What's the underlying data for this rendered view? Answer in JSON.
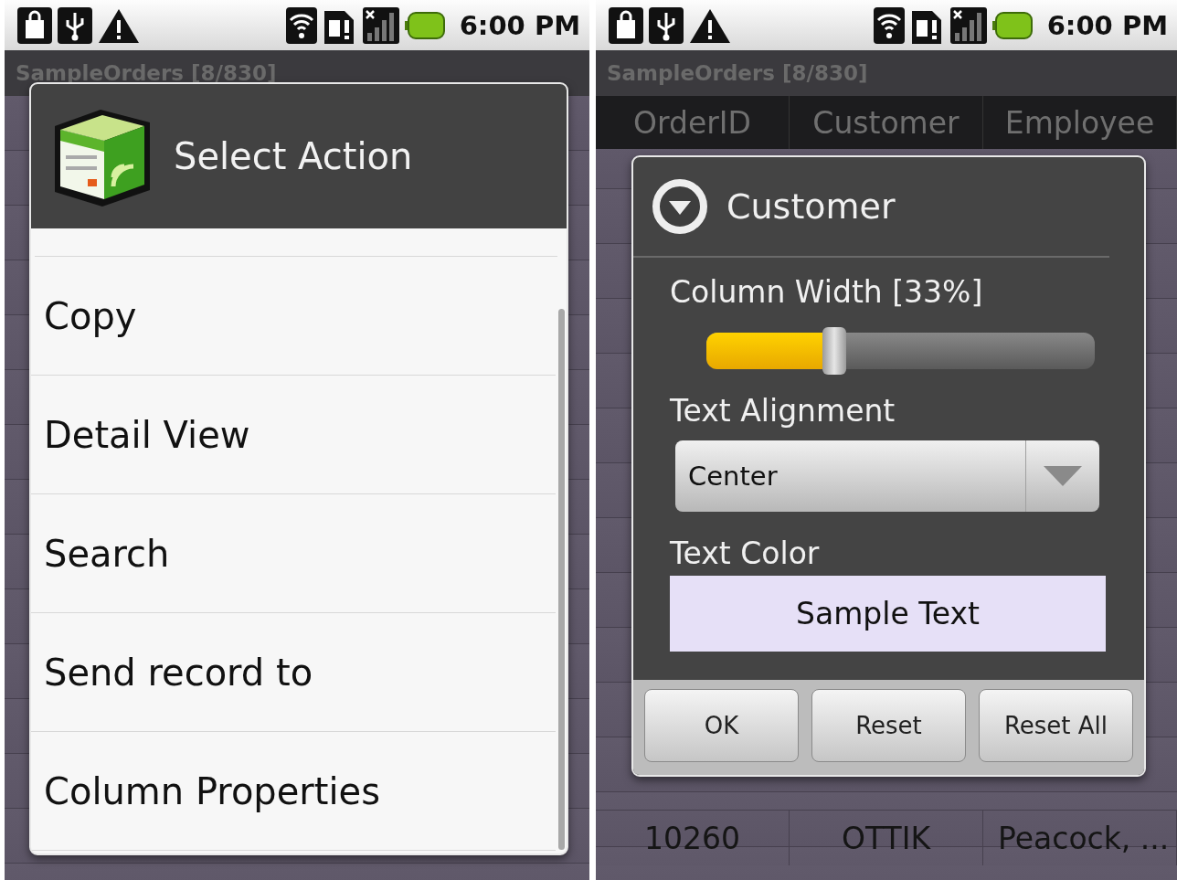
{
  "screens": [
    {
      "status_bar": {
        "time": "6:00 PM"
      },
      "app_title": "SampleOrders [8/830]",
      "dialog": {
        "kind": "action_list",
        "title": "Select Action",
        "items": [
          {
            "label": "Copy"
          },
          {
            "label": "Detail View"
          },
          {
            "label": "Search"
          },
          {
            "label": "Send record to"
          },
          {
            "label": "Column Properties"
          }
        ]
      }
    },
    {
      "status_bar": {
        "time": "6:00 PM"
      },
      "app_title": "SampleOrders [8/830]",
      "table": {
        "columns": [
          "OrderID",
          "Customer",
          "Employee"
        ],
        "rows": [
          [
            "10260",
            "OTTIK",
            "Peacock, ..."
          ]
        ]
      },
      "dialog": {
        "kind": "column_properties",
        "title": "Customer",
        "width_label": "Column Width [33%]",
        "width_slider": {
          "level": 0.33
        },
        "alignment_label": "Text Alignment",
        "alignment": "Center",
        "color_label": "Text Color",
        "sample": "Sample Text",
        "buttons": [
          "OK",
          "Reset",
          "Reset All"
        ]
      }
    }
  ]
}
